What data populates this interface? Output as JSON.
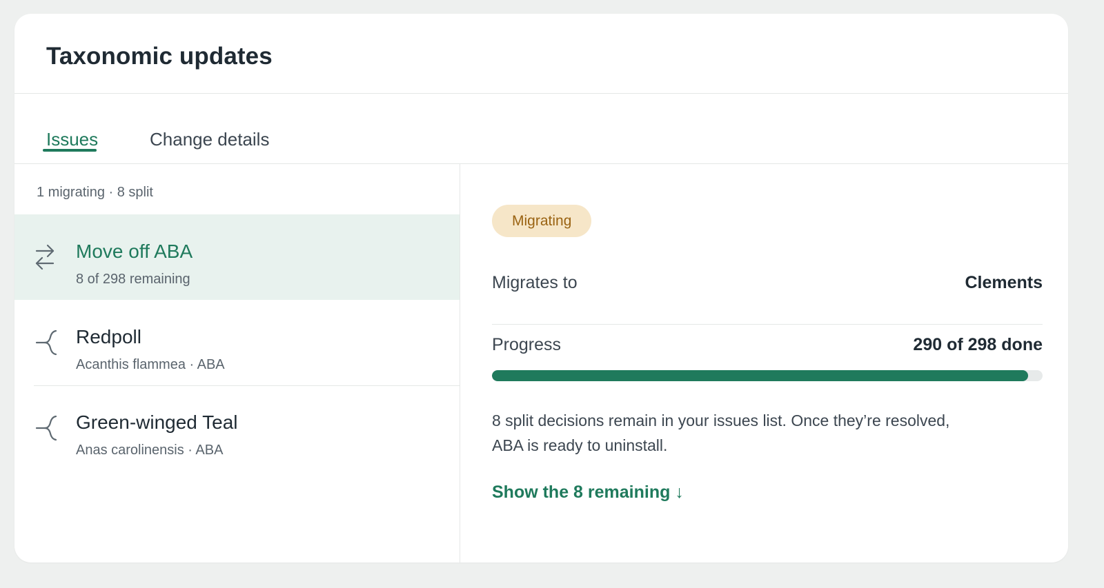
{
  "header": {
    "title": "Taxonomic updates"
  },
  "tabs": [
    {
      "label": "Issues",
      "active": true
    },
    {
      "label": "Change details",
      "active": false
    }
  ],
  "issues_panel": {
    "summary": "1 migrating · 8 split",
    "items": [
      {
        "icon": "swap-arrows-icon",
        "name": "Move off ABA",
        "sub": "8 of 298 remaining",
        "selected": true
      },
      {
        "icon": "split-icon",
        "name": "Redpoll",
        "sub": "Acanthis flammea · ABA",
        "selected": false
      },
      {
        "icon": "split-icon",
        "name": "Green-winged Teal",
        "sub": "Anas carolinensis · ABA",
        "selected": false
      }
    ]
  },
  "detail": {
    "badge": "Migrating",
    "migrates_to_label": "Migrates to",
    "migrates_to_value": "Clements",
    "progress_label": "Progress",
    "progress_value": "290 of 298 done",
    "progress_done": 290,
    "progress_total": 298,
    "note": "8 split decisions remain in your issues list. Once they’re resolved, ABA is ready to uninstall.",
    "link": "Show the 8 remaining ↓"
  },
  "colors": {
    "accent": "#1f7a5c",
    "selected_bg": "#e8f2ee",
    "badge_bg": "#f6e6c8",
    "badge_text": "#9a6312"
  }
}
